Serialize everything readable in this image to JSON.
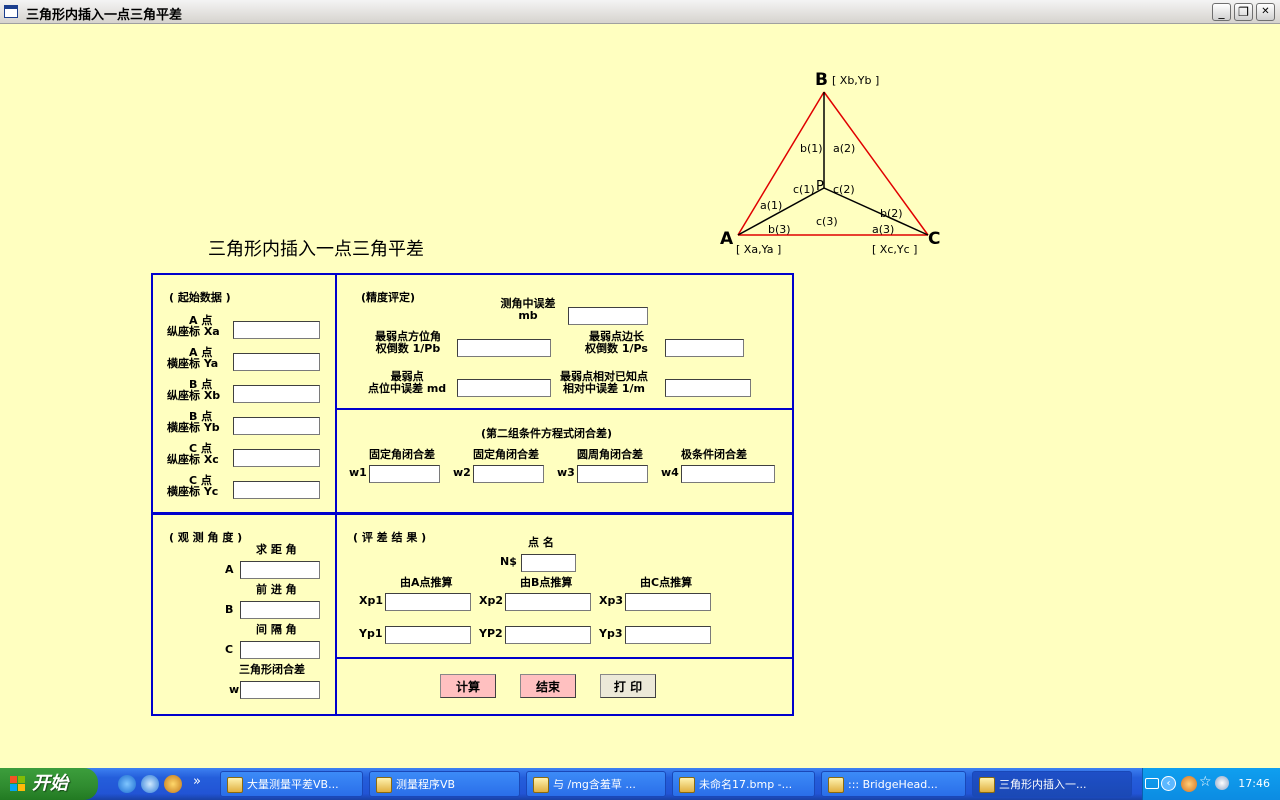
{
  "window": {
    "title": "三角形内插入一点三角平差",
    "min": "_",
    "max": "❐",
    "close": "✕"
  },
  "heading": "三角形内插入一点三角平差",
  "diagram": {
    "B": "B",
    "B_coord": "[ Xb,Yb ]",
    "A": "A",
    "A_coord": "[ Xa,Ya ]",
    "C": "C",
    "C_coord": "[ Xc,Yc ]",
    "P": "P",
    "b1": "b(1)",
    "a2": "a(2)",
    "c1": "c(1)",
    "c2": "c(2)",
    "a1": "a(1)",
    "b3": "b(3)",
    "c3": "c(3)",
    "b2": "b(2)",
    "a3": "a(3)",
    "colors": {
      "outer": "#e00000",
      "inner": "#000000"
    }
  },
  "start_data": {
    "title": "( 起始数据 )",
    "fields": [
      {
        "top": "A 点",
        "label": "纵座标 Xa",
        "value": ""
      },
      {
        "top": "A 点",
        "label": "横座标 Ya",
        "value": ""
      },
      {
        "top": "B 点",
        "label": "纵座标 Xb",
        "value": ""
      },
      {
        "top": "B 点",
        "label": "横座标 Yb",
        "value": ""
      },
      {
        "top": "C 点",
        "label": "纵座标 Xc",
        "value": ""
      },
      {
        "top": "C 点",
        "label": "横座标 Yc",
        "value": ""
      }
    ]
  },
  "precision": {
    "title": "(精度评定)",
    "mb_label1": "测角中误差",
    "mb_label2": "mb",
    "pb_label1": "最弱点方位角",
    "pb_label2": "权倒数 1/Pb",
    "ps_label1": "最弱点边长",
    "ps_label2": "权倒数 1/Ps",
    "md_label1": "最弱点",
    "md_label2": "点位中误差 md",
    "m_label1": "最弱点相对已知点",
    "m_label2": "相对中误差  1/m"
  },
  "closure": {
    "title": "(第二组条件方程式闭合差)",
    "items": [
      {
        "header": "固定角闭合差",
        "label": "w1"
      },
      {
        "header": "固定角闭合差",
        "label": "w2"
      },
      {
        "header": "圆周角闭合差",
        "label": "w3"
      },
      {
        "header": "极条件闭合差",
        "label": "w4"
      }
    ]
  },
  "observed": {
    "title": "( 观 测 角 度 )",
    "items": [
      {
        "header": "求 距 角",
        "label": "A"
      },
      {
        "header": "前 进 角",
        "label": "B"
      },
      {
        "header": "间 隔 角",
        "label": "C"
      },
      {
        "header": "三角形闭合差",
        "label": "w"
      }
    ]
  },
  "results": {
    "title": "( 评 差 结 果 )",
    "point_header": "点  名",
    "point_label": "N$",
    "col_headers": [
      "由A点推算",
      "由B点推算",
      "由C点推算"
    ],
    "x_labels": [
      "Xp1",
      "Xp2",
      "Xp3"
    ],
    "y_labels": [
      "Yp1",
      "YP2",
      "Yp3"
    ]
  },
  "buttons": {
    "calc": "计算",
    "end": "结束",
    "print": "打 印",
    "colors": {
      "pink": "#ffc0c0",
      "gray": "#ece9d8"
    }
  },
  "taskbar": {
    "start": "开始",
    "tasks": [
      "大量测量平差VB...",
      "测量程序VB",
      "与 /mg含羞草 ...",
      "未命名17.bmp -...",
      "::: BridgeHead...",
      "三角形内插入一..."
    ],
    "clock": "17:46",
    "chevron": "»"
  }
}
